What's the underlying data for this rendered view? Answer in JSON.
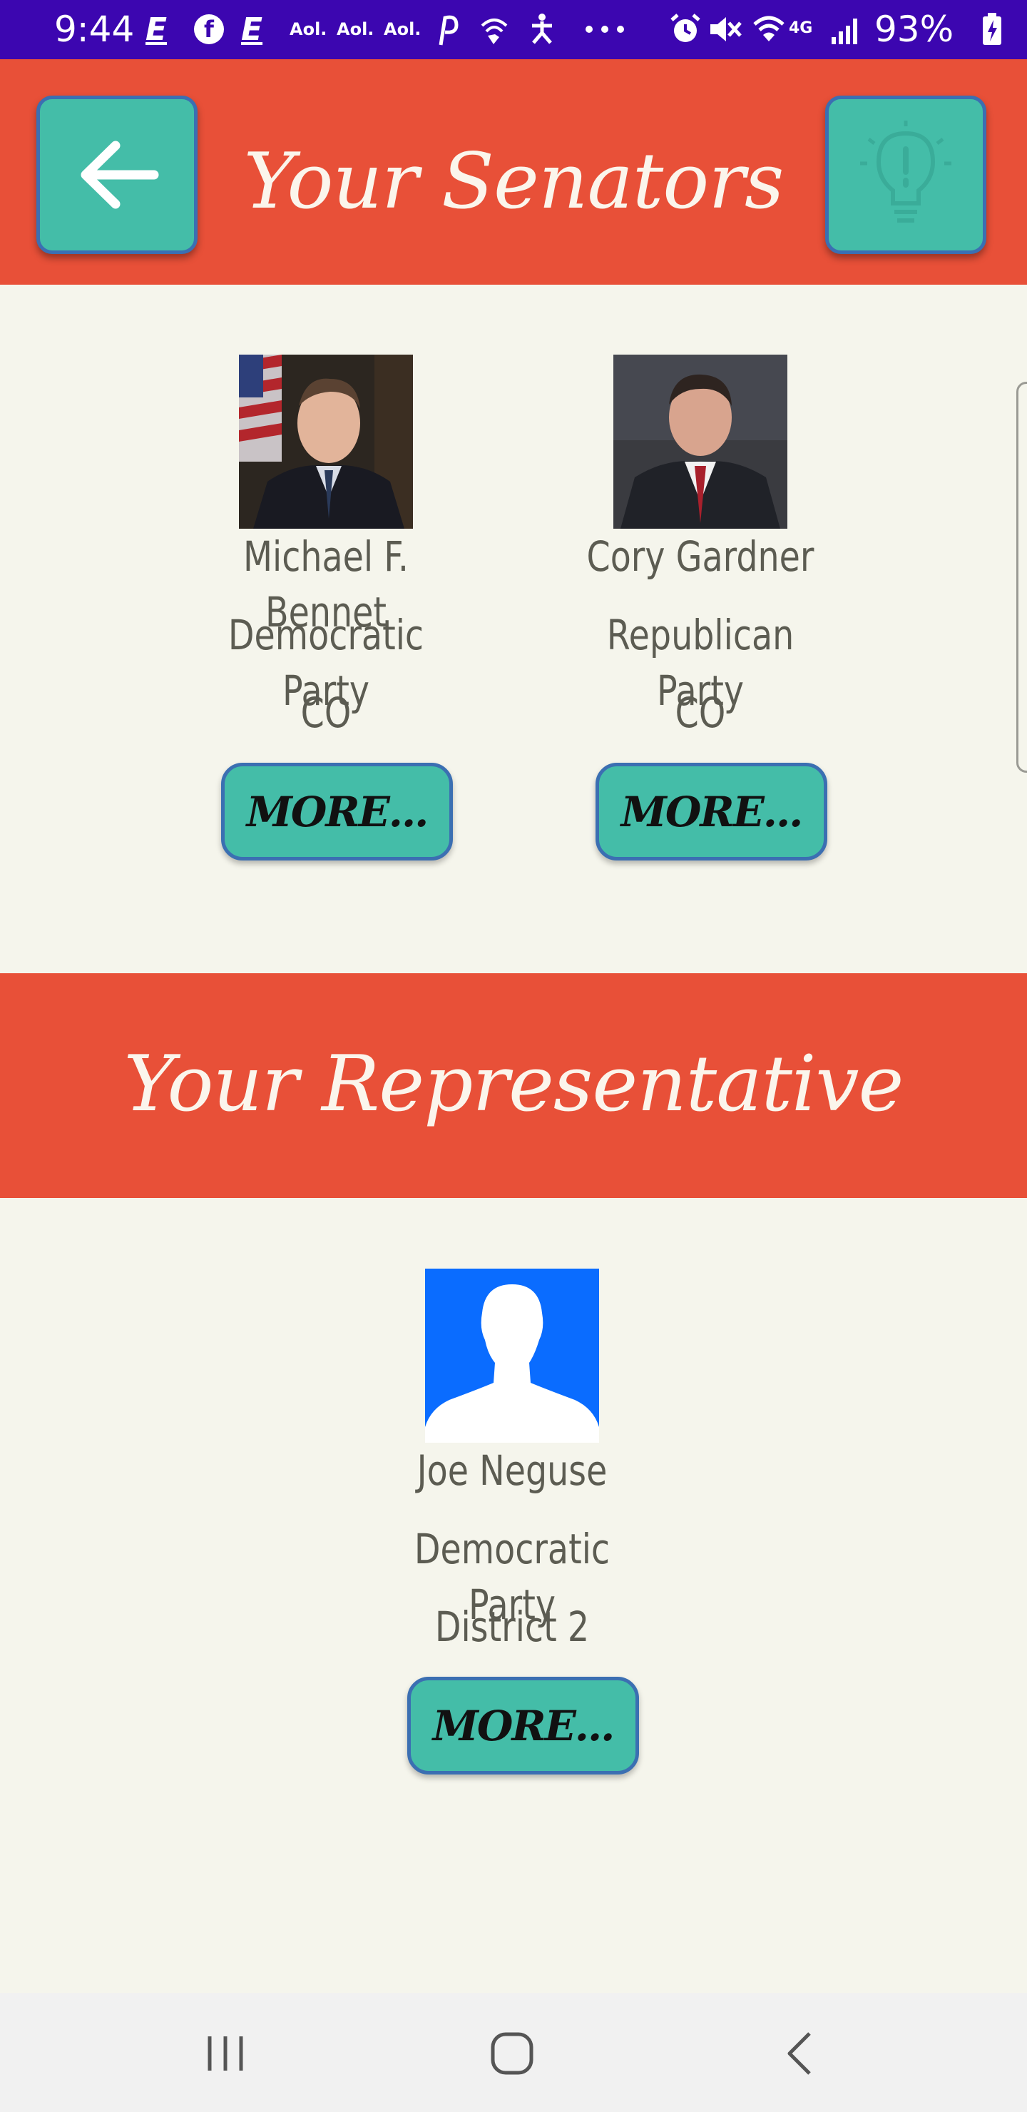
{
  "status_bar": {
    "time": "9:44",
    "notification_icons": [
      "engadget-icon",
      "facebook-icon",
      "engadget-icon",
      "aol-icon",
      "aol-icon",
      "aol-icon",
      "pinterest-icon",
      "wifi-call-icon",
      "accessibility-icon",
      "more-dots-icon"
    ],
    "aol_label": "Aol.",
    "system_icons": [
      "alarm-icon",
      "mute-icon",
      "wifi-icon",
      "lte-icon",
      "signal-icon",
      "battery-icon"
    ],
    "network": "4G",
    "battery": "93%"
  },
  "header": {
    "title": "Your Senators",
    "back_icon": "arrow-left-icon",
    "tip_icon": "lightbulb-icon"
  },
  "senators": [
    {
      "name": "Michael F. Bennet",
      "party": "Democratic Party",
      "state": "CO",
      "more_label": "MORE..."
    },
    {
      "name": "Cory Gardner",
      "party": "Republican Party",
      "state": "CO",
      "more_label": "MORE..."
    }
  ],
  "representative_section": {
    "title": "Your Representative",
    "representative": {
      "name": "Joe Neguse",
      "party": "Democratic Party",
      "district": "District 2",
      "more_label": "MORE..."
    }
  },
  "nav_bar": {
    "icons": [
      "recent-apps-icon",
      "home-icon",
      "back-icon"
    ]
  },
  "colors": {
    "status_bar": "#3c06b0",
    "header": "#e85038",
    "button": "#44bda8",
    "button_border": "#3b6fb2",
    "background": "#f5f5ec",
    "text": "#5c5c52",
    "placeholder_avatar": "#0a6cff"
  }
}
